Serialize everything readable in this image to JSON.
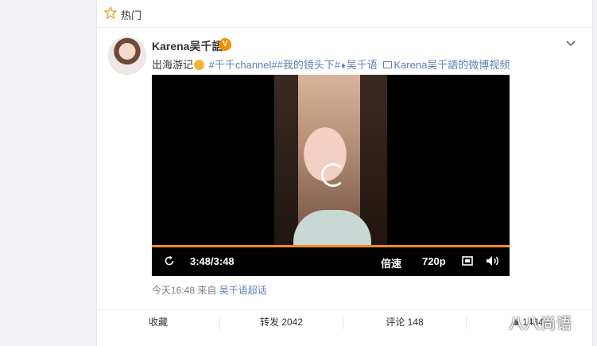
{
  "hot_label": "热门",
  "user": {
    "name": "Karena吴千語",
    "verified_mark": "V"
  },
  "post": {
    "text_start": "出海游记",
    "tag1": "#千千channel#",
    "tag2": "#我的镜头下#",
    "superchat_name": "吴千语",
    "video_link": "Karena吴千語的微博视频"
  },
  "video": {
    "time": "3:48/3:48",
    "speed": "倍速",
    "quality": "720p",
    "progress": 1.0
  },
  "meta": {
    "time": "今天16:48",
    "from_label": "来自",
    "source": "吴千语超话"
  },
  "actions": {
    "favorite": "收藏",
    "repost": "转发 2042",
    "comment": "评论 148",
    "like": "1434"
  },
  "watermark": "八八尚语",
  "colors": {
    "accent": "#f28b1d",
    "link": "#5a7fb8",
    "verified": "#f29100"
  }
}
